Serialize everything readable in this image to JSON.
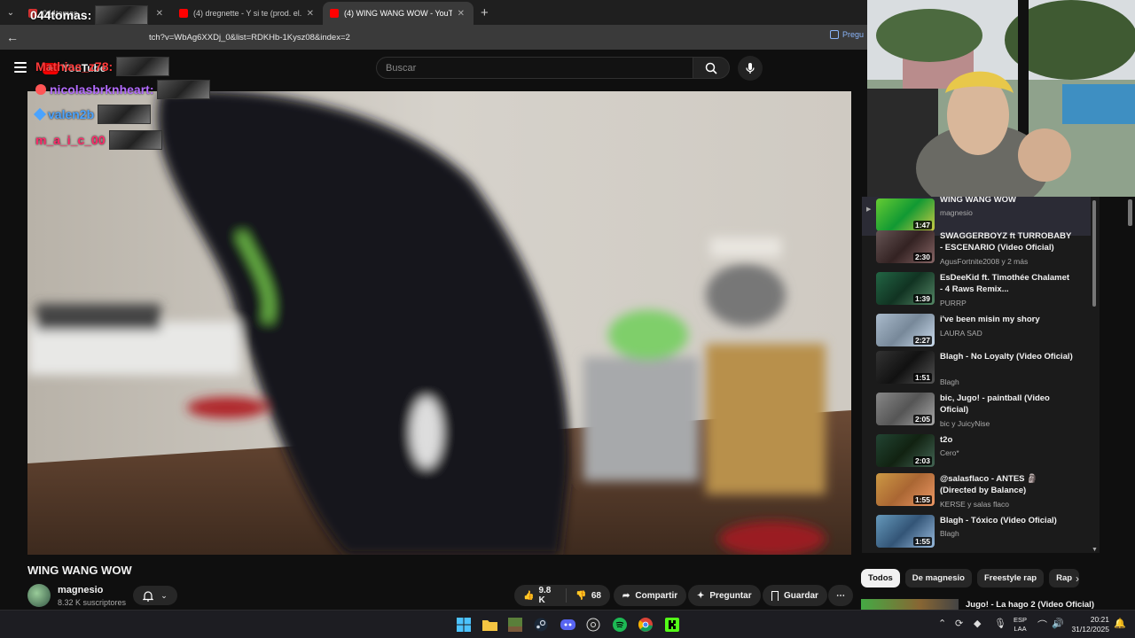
{
  "browser": {
    "tabs": [
      {
        "title": "044tomas",
        "active": false
      },
      {
        "title": "(4) dregnette - Y si te (prod. el...",
        "active": false
      },
      {
        "title": "(4) WING WANG WOW - YouTube",
        "active": true
      }
    ],
    "url": "tch?v=WbAg6XXDj_0&list=RDKHb-1Kysz08&index=2",
    "ask_label": "Pregu"
  },
  "header": {
    "logo_text": "YouTube",
    "search_placeholder": "Buscar"
  },
  "chat": [
    {
      "user": "044tomas:",
      "color": "#ffffff"
    },
    {
      "user": "Mathias_z78:",
      "color": "#ff3a3a"
    },
    {
      "user": "nicolasbrknheart:",
      "color": "#b46cff"
    },
    {
      "user": "valen2b",
      "color": "#4aa3ff"
    },
    {
      "user": "m_a_i_c_00",
      "color": "#ff2a6a"
    }
  ],
  "video": {
    "title": "WING WANG WOW",
    "channel": "magnesio",
    "subscribers": "8.32 K suscriptores",
    "likes": "9.8 K",
    "dislikes": "68",
    "share_label": "Compartir",
    "ask_label": "Preguntar",
    "save_label": "Guardar"
  },
  "playlist": [
    {
      "title": "WING WANG WOW",
      "channel": "magnesio",
      "duration": "1:47",
      "current": true
    },
    {
      "title": "SWAGGERBOYZ ft TURROBABY - ESCENARIO (Video Oficial)",
      "channel": "AgusFortnite2008 y 2 más",
      "duration": "2:30"
    },
    {
      "title": "EsDeeKid ft. Timothée Chalamet - 4 Raws Remix...",
      "channel": "PURRP",
      "duration": "1:39"
    },
    {
      "title": "i've been misin my shory",
      "channel": "LAURA SAD",
      "duration": "2:27"
    },
    {
      "title": "Blagh - No Loyalty (Video Oficial)",
      "channel": "Blagh",
      "duration": "1:51"
    },
    {
      "title": "bic, Jugo! - paintball (Video Oficial)",
      "channel": "bic y JuicyNise",
      "duration": "2:05"
    },
    {
      "title": "t2o",
      "channel": "Cero*",
      "duration": "2:03"
    },
    {
      "title": "@salasflaco - ANTES 🗿 (Directed by Balance)",
      "channel": "KERSE y salas flaco",
      "duration": "1:55"
    },
    {
      "title": "Blagh - Tóxico (Video Oficial)",
      "channel": "Blagh",
      "duration": "1:55"
    }
  ],
  "chips": [
    "Todos",
    "De magnesio",
    "Freestyle rap",
    "Rap"
  ],
  "next_video": {
    "title": "Jugo! - La hago 2 (Video Oficial)"
  },
  "taskbar": {
    "lang_top": "ESP",
    "lang_bottom": "LAA",
    "time": "20:21",
    "date": "31/12/2025"
  },
  "colors": {
    "youtube_red": "#ff0000",
    "bg": "#0f0f0f"
  }
}
